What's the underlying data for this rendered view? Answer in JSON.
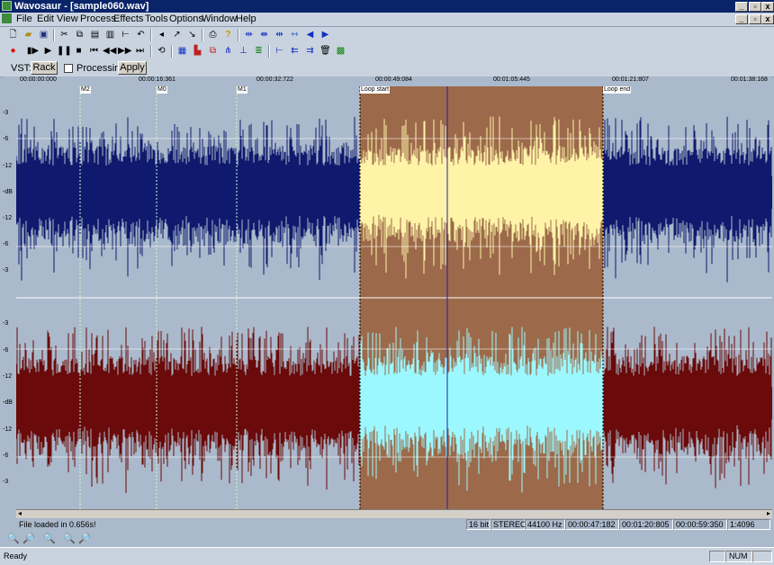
{
  "window": {
    "title": "Wavosaur - [sample060.wav]"
  },
  "menu": [
    "File",
    "Edit",
    "View",
    "Process",
    "Effects",
    "Tools",
    "Options",
    "Window",
    "Help"
  ],
  "vst": {
    "label": "VST:",
    "rack": "Rack",
    "processing": "Processing",
    "apply": "Apply"
  },
  "ruler": [
    "00:00:00:000",
    "00:00:16:361",
    "00:00:32:722",
    "00:00:49:084",
    "00:01:05:445",
    "00:01:21:807",
    "00:01:38:168"
  ],
  "markers": {
    "m2": "M2",
    "m0": "M0",
    "m1": "M1",
    "loop_start": "Loop start",
    "loop_end": "Loop end"
  },
  "db_labels": {
    "top": [
      "-3",
      "-6",
      "-12",
      "-dB",
      "-12",
      "-6",
      "-3"
    ],
    "bottom": [
      "-3",
      "-6",
      "-12",
      "-dB",
      "-12",
      "-6",
      "-3"
    ]
  },
  "info": {
    "load_msg": "File loaded in 0.656s!",
    "bits": "16 bit",
    "mode": "STEREO",
    "rate": "44100 Hz",
    "cursor": "00:00:47:182",
    "sel_end": "00:01:20:805",
    "length": "00:00:59:350",
    "zoom": "1:4096"
  },
  "status": {
    "ready": "Ready",
    "num": "NUM"
  },
  "colors": {
    "left_wave": "#0f1a6e",
    "right_wave": "#6a0a0a",
    "sel_bg": "#9c6a4a",
    "left_sel": "#fff3a8",
    "right_sel": "#9cf8ff",
    "bg": "#aab9cb",
    "title": "#0a246a"
  }
}
